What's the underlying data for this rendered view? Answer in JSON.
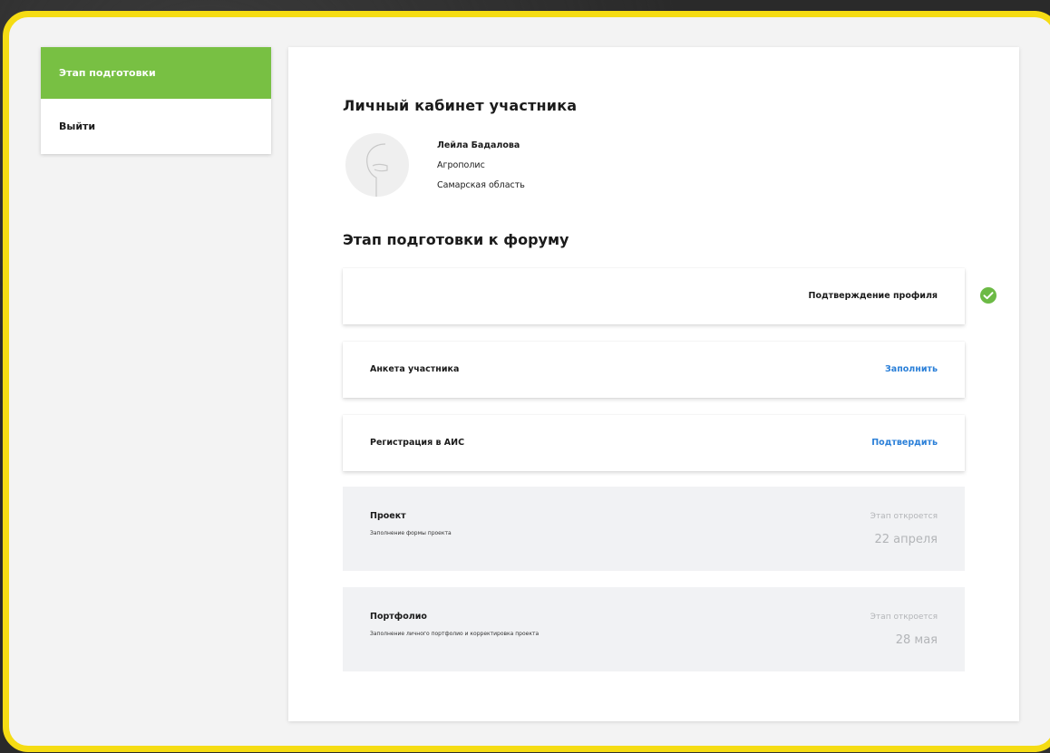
{
  "sidebar": {
    "items": [
      {
        "label": "Этап подготовки",
        "active": true
      },
      {
        "label": "Выйти",
        "active": false
      }
    ]
  },
  "main": {
    "title": "Личный кабинет участника",
    "profile": {
      "name": "Лейла Бадалова",
      "organization": "Агрополис",
      "region": "Самарская область"
    },
    "stage_title": "Этап подготовки к форуму",
    "steps": [
      {
        "label": "Подтверждение профиля",
        "status": "done"
      },
      {
        "label": "Анкета участника",
        "action": "Заполнить"
      },
      {
        "label": "Регистрация в АИС",
        "action": "Подтвердить"
      }
    ],
    "locked_steps": [
      {
        "title": "Проект",
        "subtitle": "Заполнение формы проекта",
        "opens_label": "Этап откроется",
        "date": "22 апреля"
      },
      {
        "title": "Портфолио",
        "subtitle": "Заполнение личного портфолио и корректировка проекта",
        "opens_label": "Этап откроется",
        "date": "28 мая"
      }
    ]
  },
  "colors": {
    "frame": "#f5dc13",
    "active_nav": "#78c043",
    "link": "#2a7fd8",
    "check": "#6cba45"
  },
  "icons": {
    "avatar": "avatar-placeholder-icon",
    "check": "check-circle-icon"
  }
}
